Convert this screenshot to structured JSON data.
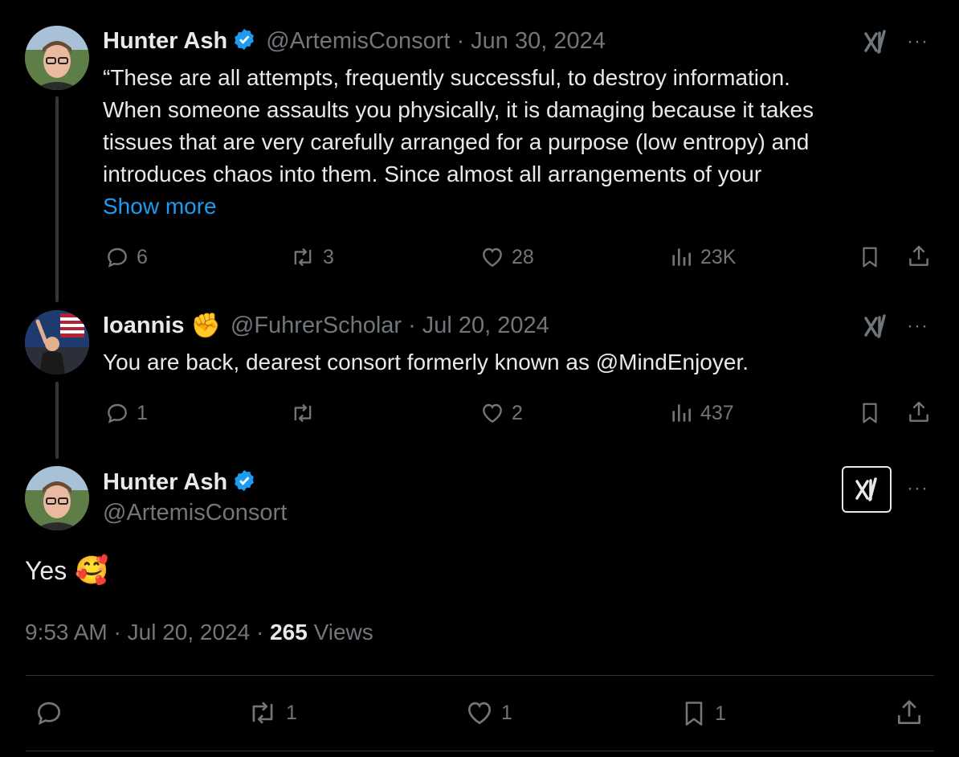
{
  "tweet1": {
    "name": "Hunter Ash",
    "handle": "@ArtemisConsort",
    "date": "Jun 30, 2024",
    "lines": [
      "“These are all attempts, frequently successful, to destroy information.",
      "When someone assaults you physically, it is damaging because it takes",
      "tissues that are very carefully arranged for a purpose (low entropy) and",
      "introduces chaos into them. Since almost all arrangements of your"
    ],
    "show_more": "Show more",
    "replies": "6",
    "reposts": "3",
    "likes": "28",
    "views": "23K"
  },
  "tweet2": {
    "name": "Ioannis",
    "emoji": "✊",
    "handle": "@FuhrerScholar",
    "date": "Jul 20, 2024",
    "text": "You are back, dearest consort formerly known as @MindEnjoyer.",
    "replies": "1",
    "reposts": "",
    "likes": "2",
    "views": "437"
  },
  "main": {
    "name": "Hunter Ash",
    "handle": "@ArtemisConsort",
    "text": "Yes",
    "emoji": "🥰",
    "time": "9:53 AM",
    "date": "Jul 20, 2024",
    "views_count": "265",
    "views_label": "Views",
    "replies": "",
    "reposts": "1",
    "likes": "1",
    "bookmarks": "1"
  },
  "separator": "·",
  "more_glyph": "···",
  "colors": {
    "accent": "#1d9bf0",
    "muted": "#71767b",
    "text": "#e7e9ea"
  },
  "icons": [
    "reply-icon",
    "repost-icon",
    "like-icon",
    "views-icon",
    "bookmark-icon",
    "share-icon",
    "grok-icon",
    "more-icon",
    "verified-icon"
  ]
}
